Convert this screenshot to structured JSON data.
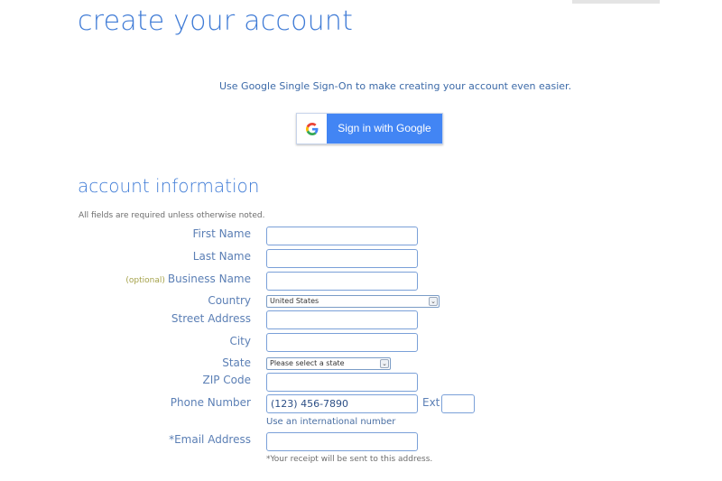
{
  "page": {
    "title": "create your account"
  },
  "sso": {
    "prompt": "Use Google Single Sign-On to make creating your account even easier.",
    "button_label": "Sign in with Google",
    "button_color": "#4285f4",
    "icon": "google-g-icon"
  },
  "account": {
    "section_title": "account information",
    "note": "All fields are required unless otherwise noted.",
    "fields": {
      "first_name": {
        "label": "First Name",
        "value": ""
      },
      "last_name": {
        "label": "Last Name",
        "value": ""
      },
      "business_name": {
        "optional_tag": "(optional)",
        "label": "Business Name",
        "value": ""
      },
      "country": {
        "label": "Country",
        "selected": "United States"
      },
      "street_address": {
        "label": "Street Address",
        "value": ""
      },
      "city": {
        "label": "City",
        "value": ""
      },
      "state": {
        "label": "State",
        "selected": "Please select a state"
      },
      "zip": {
        "label": "ZIP Code",
        "value": ""
      },
      "phone": {
        "label": "Phone Number",
        "placeholder": "(123) 456-7890",
        "ext_label": "Ext",
        "international_link": "Use an international number"
      },
      "email": {
        "label": "*Email Address",
        "value": "",
        "help": "*Your receipt will be sent to this address."
      }
    }
  }
}
